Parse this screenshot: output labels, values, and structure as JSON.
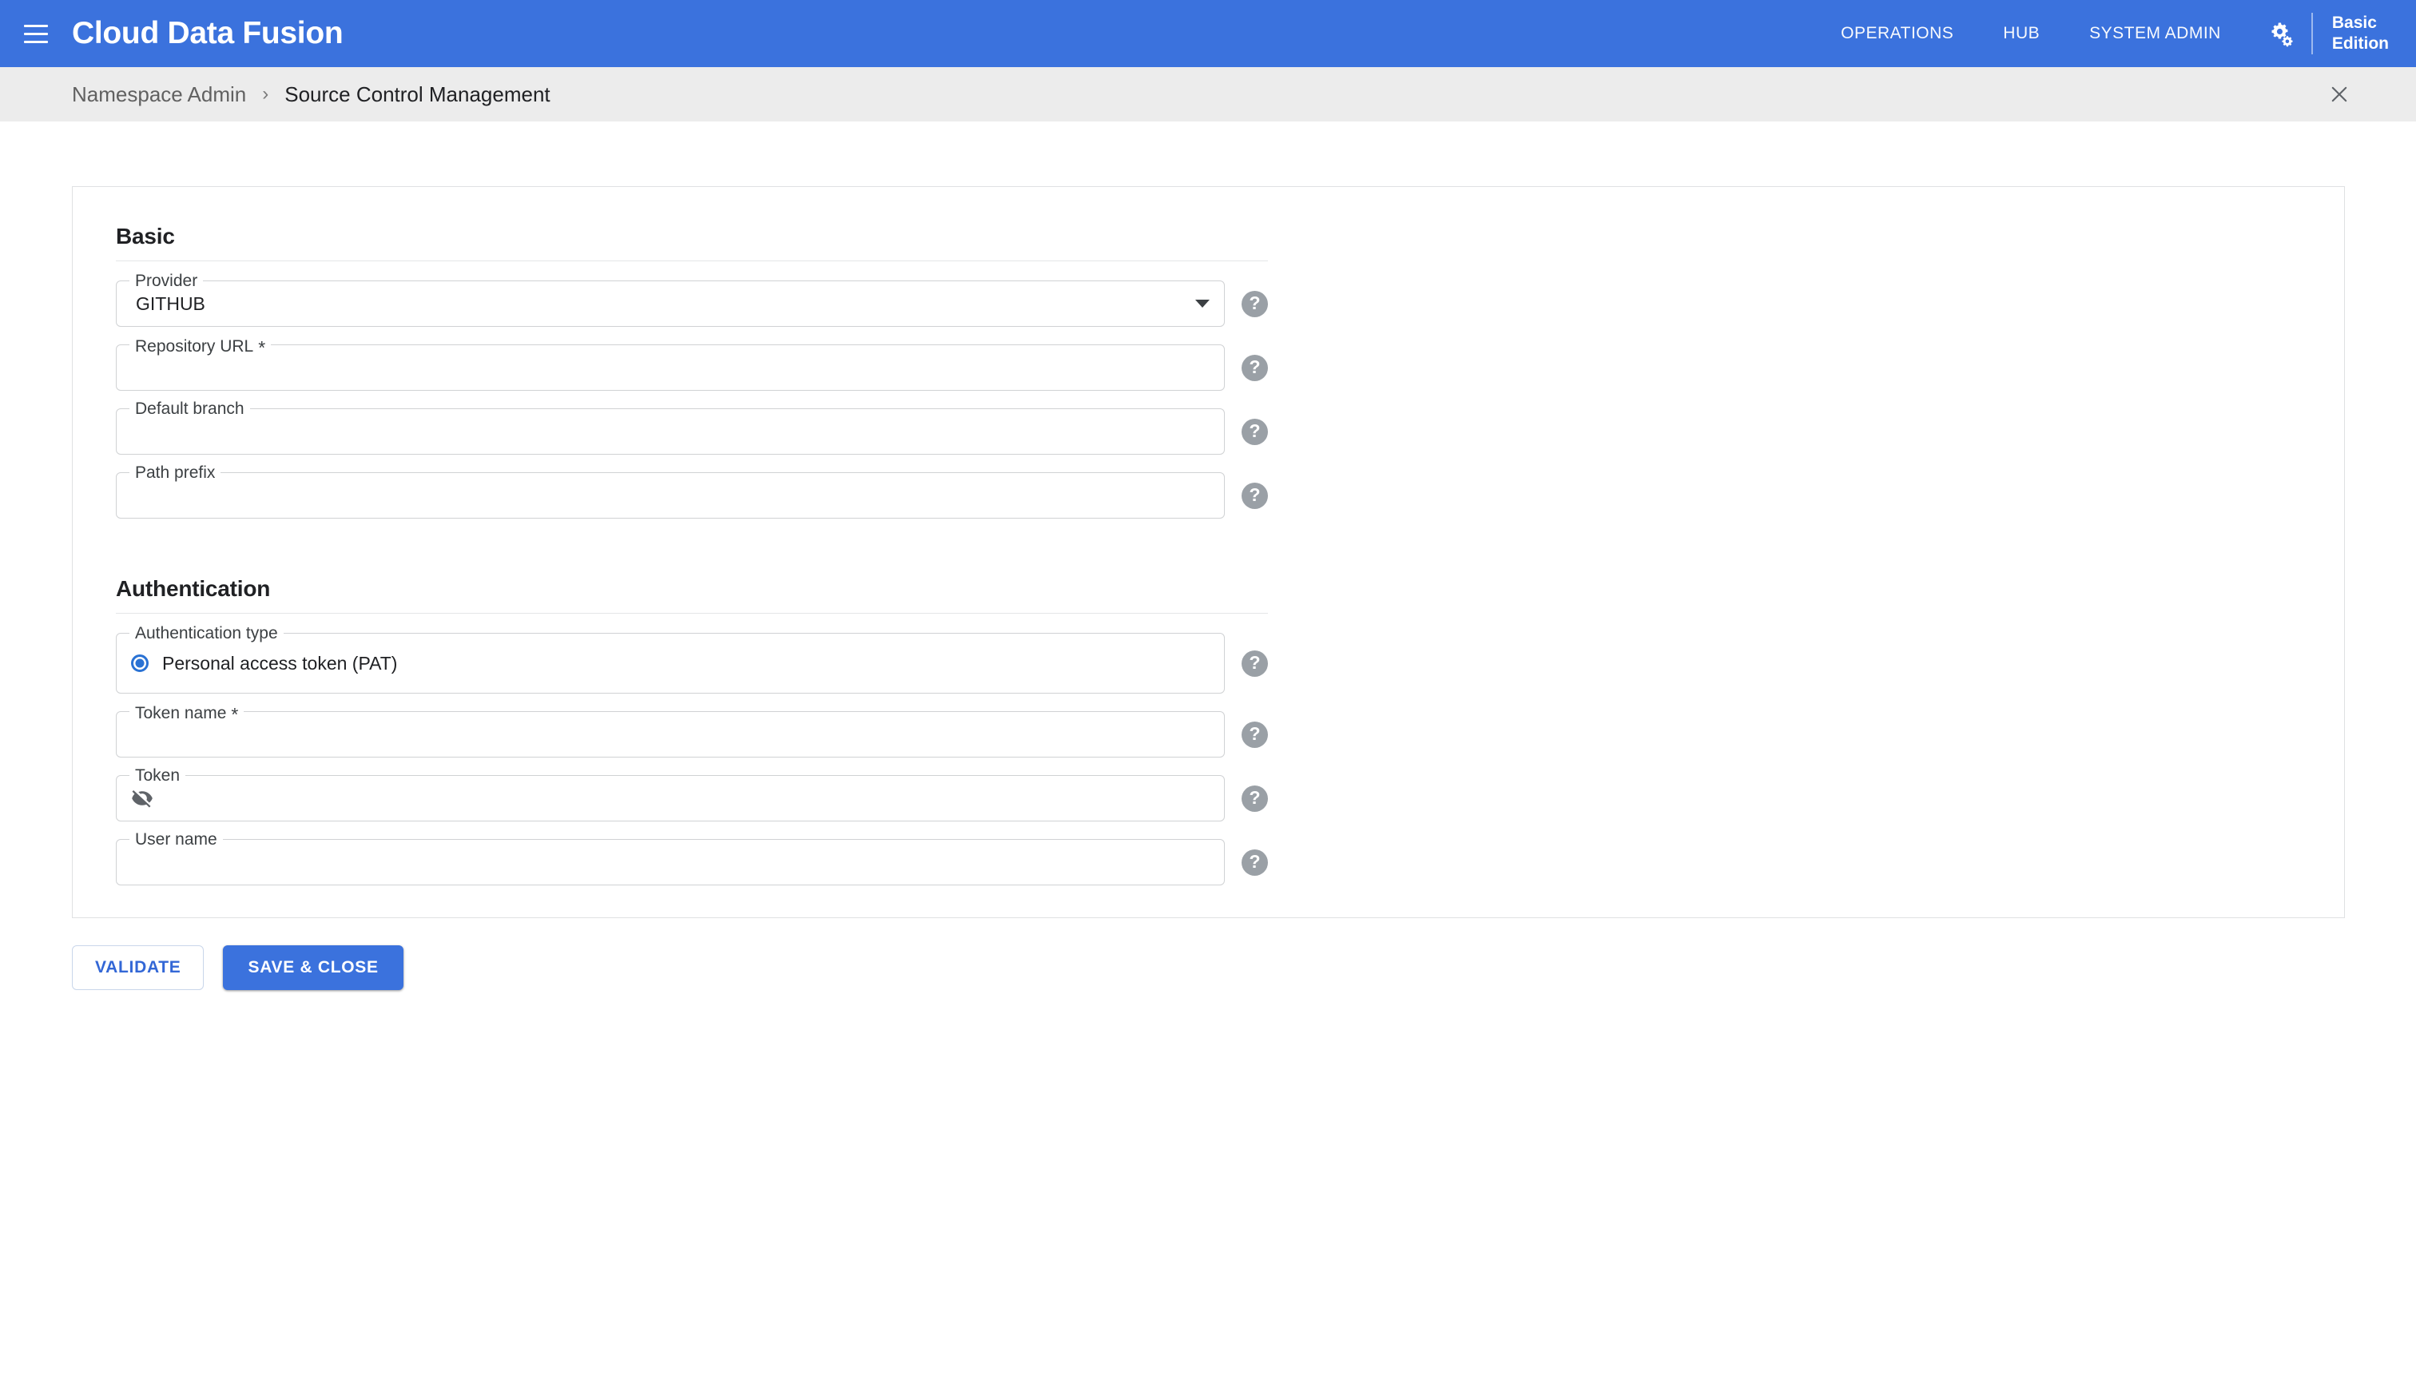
{
  "appbar": {
    "menu_icon": "hamburger-menu-icon",
    "brand": "Cloud Data Fusion",
    "nav": [
      {
        "label": "OPERATIONS",
        "name": "operations"
      },
      {
        "label": "HUB",
        "name": "hub"
      },
      {
        "label": "SYSTEM ADMIN",
        "name": "system-admin"
      }
    ],
    "settings_icon": "gear-icon",
    "edition_line1": "Basic",
    "edition_line2": "Edition"
  },
  "breadcrumb": {
    "parent": "Namespace Admin",
    "separator": "›",
    "current": "Source Control Management",
    "close_icon": "close-icon"
  },
  "form": {
    "sections": [
      {
        "title": "Basic"
      },
      {
        "title": "Authentication"
      }
    ],
    "provider": {
      "label": "Provider",
      "value": "GITHUB",
      "dropdown_icon": "chevron-down-icon",
      "help_icon": "help-icon",
      "help_glyph": "?"
    },
    "repository_url": {
      "label": "Repository URL",
      "required_marker": "*",
      "value": "",
      "placeholder": ""
    },
    "default_branch": {
      "label": "Default branch",
      "value": "",
      "placeholder": ""
    },
    "path_prefix": {
      "label": "Path prefix",
      "value": "",
      "placeholder": ""
    },
    "auth_type": {
      "label": "Authentication type",
      "option_label": "Personal access token (PAT)",
      "selected": true
    },
    "token_name": {
      "label": "Token name",
      "required_marker": "*",
      "value": "",
      "placeholder": ""
    },
    "token": {
      "label": "Token",
      "value": "",
      "placeholder": "",
      "visibility_icon": "eye-off-icon"
    },
    "user_name": {
      "label": "User name",
      "value": "",
      "placeholder": ""
    }
  },
  "actions": {
    "validate_label": "VALIDATE",
    "save_close_label": "SAVE & CLOSE"
  },
  "colors": {
    "appbar_blue": "#3b72dd",
    "primary_blue": "#3367d6",
    "radio_blue": "#2a72d4",
    "breadcrumb_bg": "#ececec",
    "help_gray": "#9aa0a6"
  }
}
